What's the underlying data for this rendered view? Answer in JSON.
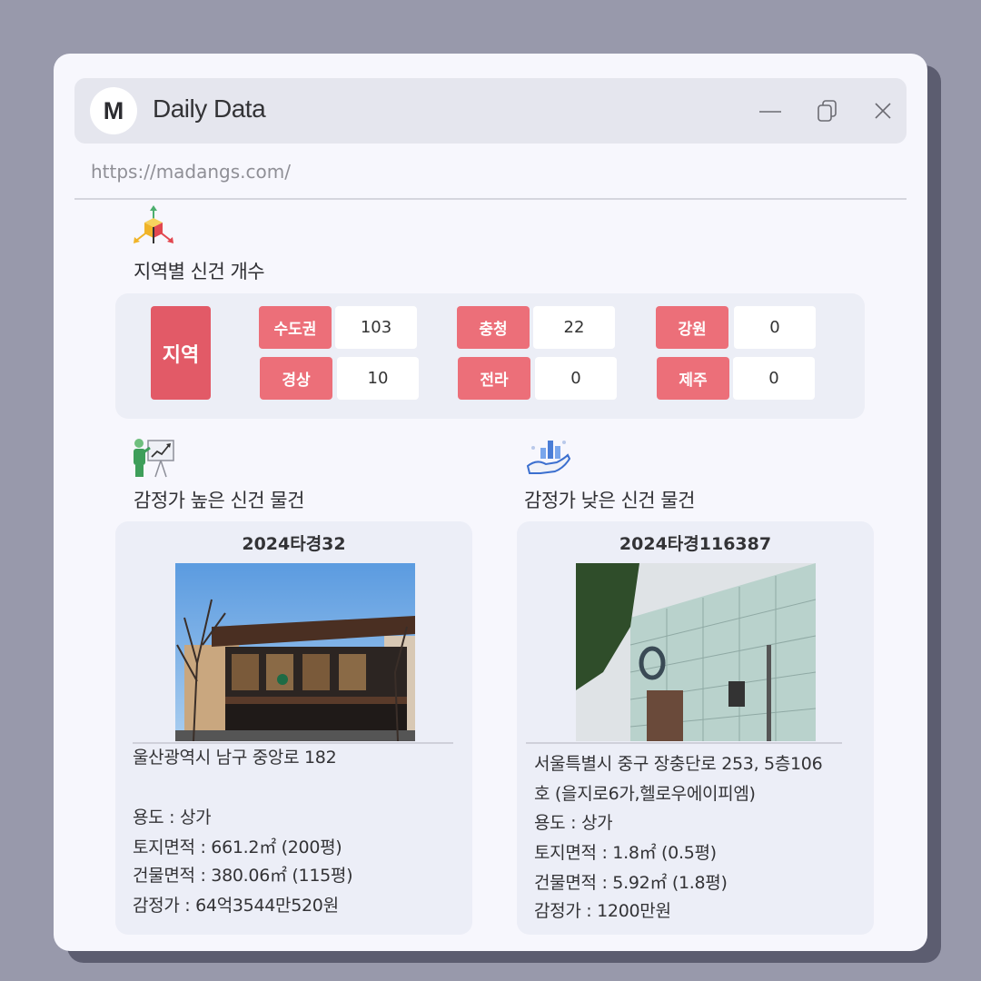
{
  "window": {
    "logo_letter": "M",
    "title": "Daily Data",
    "url": "https://madangs.com/"
  },
  "region_section": {
    "title": "지역별 신건 개수",
    "main_label": "지역",
    "regions": [
      {
        "name": "수도권",
        "count": "103"
      },
      {
        "name": "충청",
        "count": "22"
      },
      {
        "name": "강원",
        "count": "0"
      },
      {
        "name": "경상",
        "count": "10"
      },
      {
        "name": "전라",
        "count": "0"
      },
      {
        "name": "제주",
        "count": "0"
      }
    ]
  },
  "high_section": {
    "title": "감정가 높은 신건 물건",
    "case_no": "2024타경32",
    "address": "울산광역시 남구 중앙로 182",
    "usage": "용도 : 상가",
    "land_area": "토지면적 : 661.2㎡ (200평)",
    "building_area": "건물면적 : 380.06㎡ (115평)",
    "appraisal": "감정가 : 64억3544만520원"
  },
  "low_section": {
    "title": "감정가 낮은 신건 물건",
    "case_no": "2024타경116387",
    "address_line1": "서울특별시 중구 장충단로 253, 5층106",
    "address_line2": "호 (을지로6가,헬로우에이피엠)",
    "usage": "용도 : 상가",
    "land_area": "토지면적 : 1.8㎡ (0.5평)",
    "building_area": "건물면적 : 5.92㎡ (1.8평)",
    "appraisal": "감정가 : 1200만원"
  },
  "colors": {
    "accent_red": "#e25a67",
    "label_red": "#ec6f79",
    "panel_bg": "#eceef6"
  },
  "icons": {
    "minimize": "minimize-icon",
    "restore": "restore-icon",
    "close": "close-icon",
    "region": "axes-cube-icon",
    "high": "presentation-chart-icon",
    "low": "hand-bar-chart-icon"
  }
}
